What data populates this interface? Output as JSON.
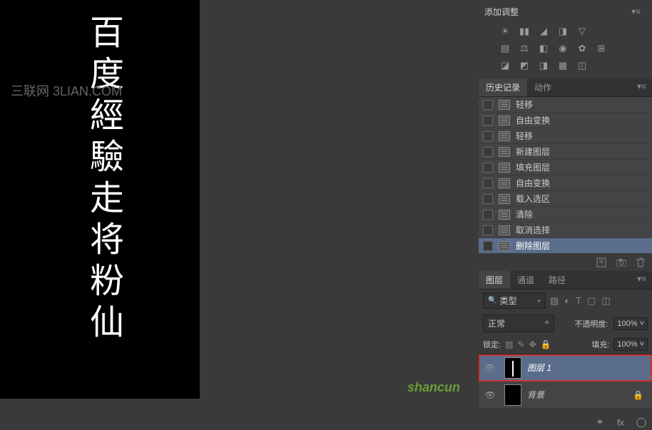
{
  "canvas": {
    "calligraphy_chars": [
      "百",
      "度",
      "經",
      "驗",
      "走",
      "将",
      "粉",
      "仙"
    ],
    "watermark": "三联网 3LIAN.COM",
    "logo": "shancun"
  },
  "adjustments": {
    "title": "添加调整"
  },
  "history_panel": {
    "tabs": {
      "history": "历史记录",
      "actions": "动作"
    },
    "items": [
      {
        "label": "轻移"
      },
      {
        "label": "自由变换"
      },
      {
        "label": "轻移"
      },
      {
        "label": "新建图层"
      },
      {
        "label": "填充图层"
      },
      {
        "label": "自由变换"
      },
      {
        "label": "载入选区"
      },
      {
        "label": "清除"
      },
      {
        "label": "取消选择"
      },
      {
        "label": "删除图层",
        "selected": true
      }
    ]
  },
  "layers_panel": {
    "tabs": {
      "layers": "图层",
      "channels": "通道",
      "paths": "路径"
    },
    "type_filter": "类型",
    "blend_mode": "正常",
    "opacity_label": "不透明度:",
    "opacity_value": "100%",
    "lock_label": "锁定:",
    "fill_label": "填充:",
    "fill_value": "100%",
    "layers": [
      {
        "name": "图层 1",
        "selected": true,
        "highlighted": true,
        "visible": true,
        "thumb": "text"
      },
      {
        "name": "背景",
        "visible": true,
        "locked": true,
        "thumb": "bg"
      }
    ]
  }
}
